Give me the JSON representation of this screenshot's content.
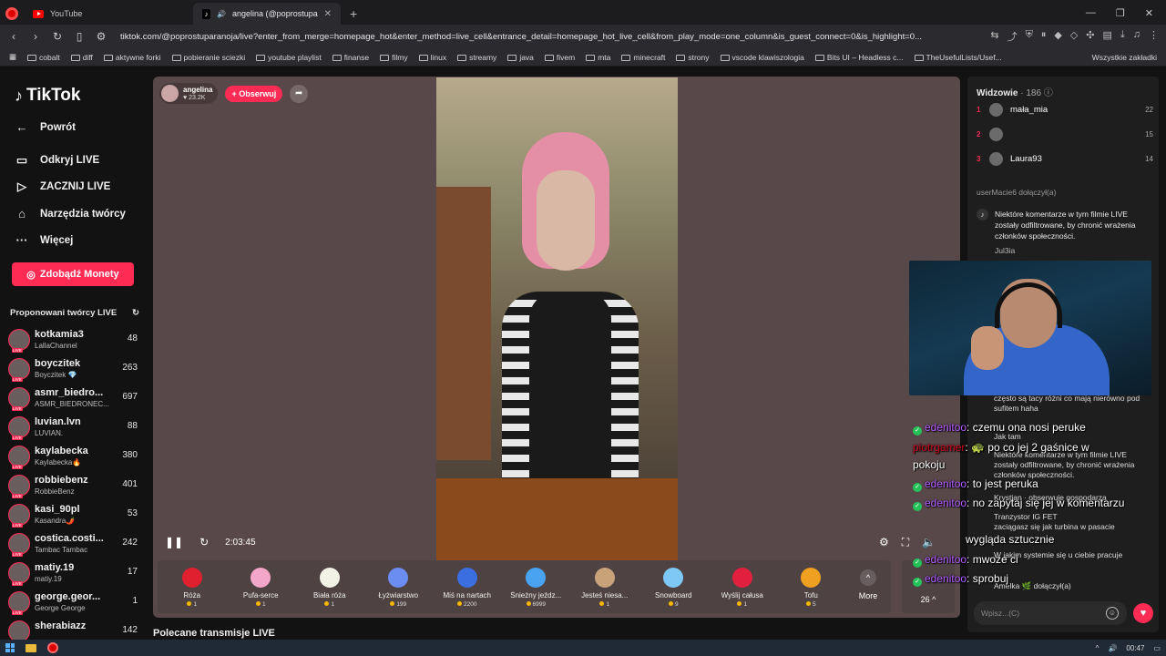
{
  "browser": {
    "tabs": [
      {
        "label": "YouTube"
      },
      {
        "label": "angelina (@poprostuparanoj"
      }
    ],
    "url": "tiktok.com/@poprostuparanoja/live?enter_from_merge=homepage_hot&enter_method=live_cell&entrance_detail=homepage_hot_live_cell&from_play_mode=one_column&is_guest_connect=0&is_highlight=0...",
    "bookmarks": [
      "cobalt",
      "diff",
      "aktywne forki",
      "pobieranie sciezki",
      "youtube playlist",
      "finanse",
      "filmy",
      "linux",
      "streamy",
      "java",
      "fivem",
      "mta",
      "minecraft",
      "strony",
      "vscode klawiszologia",
      "Bits UI – Headless c...",
      "TheUsefulLists/Usef..."
    ],
    "bookmarks_right": "Wszystkie zakładki"
  },
  "sidebar": {
    "logo": "TikTok",
    "back": "Powrót",
    "nav": [
      "Odkryj LIVE",
      "ZACZNIJ LIVE",
      "Narzędzia twórcy",
      "Więcej"
    ],
    "coins_button": "Zdobądź Monety",
    "suggested_heading": "Proponowani twórcy LIVE",
    "creators": [
      {
        "name": "kotkamia3",
        "sub": "LallaChannel",
        "count": "48"
      },
      {
        "name": "boyczitek",
        "sub": "Boyczitek 💎",
        "count": "263"
      },
      {
        "name": "asmr_biedro...",
        "sub": "ASMR_BIEDRONEC...",
        "count": "697"
      },
      {
        "name": "luvian.lvn",
        "sub": "LUVIAN.",
        "count": "88"
      },
      {
        "name": "kaylabecka",
        "sub": "Kaylabecka🔥",
        "count": "380"
      },
      {
        "name": "robbiebenz",
        "sub": "RobbieBenz",
        "count": "401"
      },
      {
        "name": "kasi_90pl",
        "sub": "Kasandra🌶️",
        "count": "53"
      },
      {
        "name": "costica.costi...",
        "sub": "Tambac Tambac",
        "count": "242"
      },
      {
        "name": "matiy.19",
        "sub": "matiy.19",
        "count": "17"
      },
      {
        "name": "george.geor...",
        "sub": "George George",
        "count": "1"
      },
      {
        "name": "sherabiazz",
        "sub": "",
        "count": "142"
      }
    ]
  },
  "live": {
    "host_name": "angelina",
    "host_likes": "23.2K",
    "follow_label": "+ Obserwuj",
    "elapsed": "2:03:45",
    "gifts": [
      {
        "name": "Róża",
        "price": "1",
        "color": "#e0202e"
      },
      {
        "name": "Pufa-serce",
        "price": "1",
        "color": "#f3a6c8"
      },
      {
        "name": "Biała róża",
        "price": "1",
        "color": "#f2f2e6"
      },
      {
        "name": "Łyżwiarstwo",
        "price": "199",
        "color": "#6b8cf0"
      },
      {
        "name": "Miś na nartach",
        "price": "2200",
        "color": "#3b6ee0"
      },
      {
        "name": "Śnieżny jeźdz...",
        "price": "6999",
        "color": "#4aa3f0"
      },
      {
        "name": "Jesteś niesa...",
        "price": "1",
        "color": "#c9a27a"
      },
      {
        "name": "Snowboard",
        "price": "9",
        "color": "#7ec8f5"
      },
      {
        "name": "Wyślij całusa",
        "price": "1",
        "color": "#e0203e"
      },
      {
        "name": "Tofu",
        "price": "5",
        "color": "#f0a020"
      }
    ],
    "more_label": "More",
    "gift_count": "26"
  },
  "recommended_title": "Polecane transmisje LIVE",
  "viewers": {
    "title": "Widzowie",
    "count": "186",
    "top": [
      {
        "rank": "1",
        "name": "mała_mia",
        "score": "22"
      },
      {
        "rank": "2",
        "name": "",
        "score": "15"
      },
      {
        "rank": "3",
        "name": "Laura93",
        "score": "14"
      }
    ]
  },
  "chat": {
    "faded_join": "userMacie6  dołączył(a)",
    "system_message": "Niektóre komentarze w tym filmie LIVE zostały odfiltrowane, by chronić wrażenia członków społeczności.",
    "user_jul": "Jul3ia",
    "bg_messages": [
      "często są tacy różni co mają nierówno pod sufitem haha",
      "Jak tam",
      "Niektóre komentarze w tym filmie LIVE zostały odfiltrowane, by chronić wrażenia członków społeczności.",
      "Krystian · obserwuje gospodarza",
      "Tranzystor IG FET",
      "zaciągasz się jak turbina w pasacie",
      "W jakim systemie się u ciebie pracuje",
      "Amelka 🌿 dołączył(a)"
    ],
    "input_placeholder": "Wpisz...(C)"
  },
  "overlay_chat": [
    {
      "user": "edenitoo",
      "text": ": czemu ona nosi peruke"
    },
    {
      "user": "piotrgamer",
      "text": ": 🐢 po co jej 2 gaśnice w"
    },
    {
      "user": "",
      "text": "pokoju"
    },
    {
      "user": "edenitoo",
      "text": ": to jest peruka"
    },
    {
      "user": "edenitoo",
      "text": ": no zapytaj się jej w komentarzu"
    },
    {
      "user": "",
      "text": "wygląda sztucznie"
    },
    {
      "user": "edenitoo",
      "text": ": mwoże ci"
    },
    {
      "user": "edenitoo",
      "text": ": sprobuj"
    }
  ],
  "taskbar": {
    "time": "00:47"
  },
  "colors": {
    "accent": "#fe2c55",
    "video_bg": "#594849",
    "user1": "#b35cff",
    "user2": "#d0021b"
  }
}
